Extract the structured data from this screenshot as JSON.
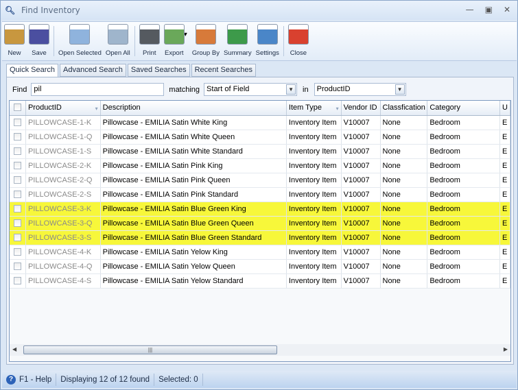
{
  "window": {
    "title": "Find Inventory"
  },
  "toolbar": [
    {
      "label": "New",
      "icon": "new-icon",
      "color": "#c8973f"
    },
    {
      "label": "Save",
      "icon": "save-icon",
      "color": "#4b4fa0"
    },
    {
      "label": "Open Selected",
      "icon": "open-selected-icon",
      "color": "#8fb3dd"
    },
    {
      "label": "Open All",
      "icon": "open-all-icon",
      "color": "#9fb5cc"
    },
    {
      "label": "Print",
      "icon": "print-icon",
      "color": "#555a60"
    },
    {
      "label": "Export",
      "icon": "export-icon",
      "color": "#6aa85a"
    },
    {
      "label": "Group By",
      "icon": "group-by-icon",
      "color": "#d77a3a"
    },
    {
      "label": "Summary",
      "icon": "summary-icon",
      "color": "#3d9a4a"
    },
    {
      "label": "Settings",
      "icon": "settings-icon",
      "color": "#4a86c8"
    },
    {
      "label": "Close",
      "icon": "close-icon",
      "color": "#d9412f"
    }
  ],
  "tabs": [
    "Quick Search",
    "Advanced Search",
    "Saved Searches",
    "Recent Searches"
  ],
  "find": {
    "label": "Find",
    "value": "pil",
    "matching_label": "matching",
    "matching_value": "Start of Field",
    "in_label": "in",
    "in_value": "ProductID"
  },
  "grid": {
    "columns": [
      "ProductID",
      "Description",
      "Item Type",
      "Vendor ID",
      "Classfication",
      "Category",
      "U"
    ],
    "rows": [
      {
        "id": "PILLOWCASE-1-K",
        "desc": "Pillowcase - EMILIA Satin White King",
        "type": "Inventory Item",
        "vendor": "V10007",
        "cls": "None",
        "cat": "Bedroom",
        "u": "E",
        "hl": false
      },
      {
        "id": "PILLOWCASE-1-Q",
        "desc": "Pillowcase - EMILIA Satin White Queen",
        "type": "Inventory Item",
        "vendor": "V10007",
        "cls": "None",
        "cat": "Bedroom",
        "u": "E",
        "hl": false
      },
      {
        "id": "PILLOWCASE-1-S",
        "desc": "Pillowcase - EMILIA Satin White Standard",
        "type": "Inventory Item",
        "vendor": "V10007",
        "cls": "None",
        "cat": "Bedroom",
        "u": "E",
        "hl": false
      },
      {
        "id": "PILLOWCASE-2-K",
        "desc": "Pillowcase - EMILIA Satin Pink King",
        "type": "Inventory Item",
        "vendor": "V10007",
        "cls": "None",
        "cat": "Bedroom",
        "u": "E",
        "hl": false
      },
      {
        "id": "PILLOWCASE-2-Q",
        "desc": "Pillowcase - EMILIA Satin Pink Queen",
        "type": "Inventory Item",
        "vendor": "V10007",
        "cls": "None",
        "cat": "Bedroom",
        "u": "E",
        "hl": false
      },
      {
        "id": "PILLOWCASE-2-S",
        "desc": "Pillowcase - EMILIA Satin Pink Standard",
        "type": "Inventory Item",
        "vendor": "V10007",
        "cls": "None",
        "cat": "Bedroom",
        "u": "E",
        "hl": false
      },
      {
        "id": "PILLOWCASE-3-K",
        "desc": "Pillowcase - EMILIA Satin Blue Green King",
        "type": "Inventory Item",
        "vendor": "V10007",
        "cls": "None",
        "cat": "Bedroom",
        "u": "E",
        "hl": true
      },
      {
        "id": "PILLOWCASE-3-Q",
        "desc": "Pillowcase - EMILIA Satin Blue Green Queen",
        "type": "Inventory Item",
        "vendor": "V10007",
        "cls": "None",
        "cat": "Bedroom",
        "u": "E",
        "hl": true
      },
      {
        "id": "PILLOWCASE-3-S",
        "desc": "Pillowcase - EMILIA Satin Blue Green Standard",
        "type": "Inventory Item",
        "vendor": "V10007",
        "cls": "None",
        "cat": "Bedroom",
        "u": "E",
        "hl": true
      },
      {
        "id": "PILLOWCASE-4-K",
        "desc": "Pillowcase - EMILIA Satin Yelow King",
        "type": "Inventory Item",
        "vendor": "V10007",
        "cls": "None",
        "cat": "Bedroom",
        "u": "E",
        "hl": false
      },
      {
        "id": "PILLOWCASE-4-Q",
        "desc": "Pillowcase - EMILIA Satin Yelow Queen",
        "type": "Inventory Item",
        "vendor": "V10007",
        "cls": "None",
        "cat": "Bedroom",
        "u": "E",
        "hl": false
      },
      {
        "id": "PILLOWCASE-4-S",
        "desc": "Pillowcase - EMILIA Satin Yelow Standard",
        "type": "Inventory Item",
        "vendor": "V10007",
        "cls": "None",
        "cat": "Bedroom",
        "u": "E",
        "hl": false
      }
    ],
    "highlight_color": "#f7f73a"
  },
  "status": {
    "help": "F1 - Help",
    "count": "Displaying 12 of 12 found",
    "selected": "Selected: 0"
  }
}
